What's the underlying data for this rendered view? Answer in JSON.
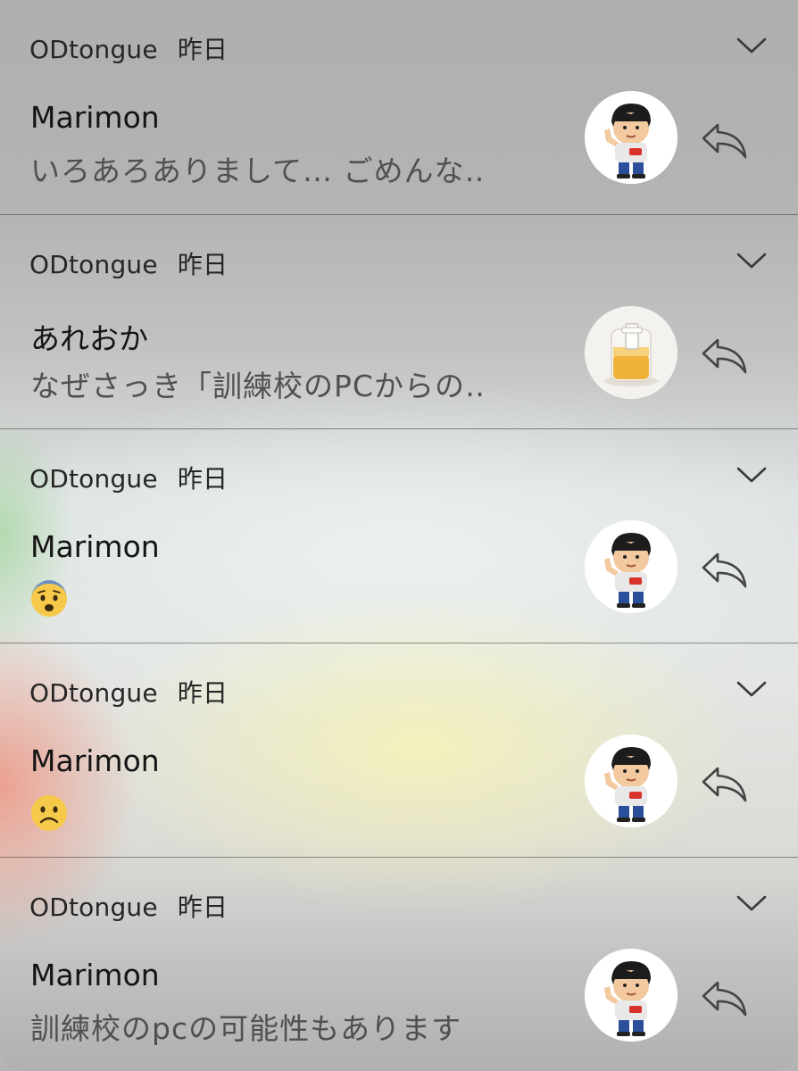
{
  "notifications": [
    {
      "app": "ODtongue",
      "time": "昨日",
      "sender": "Marimon",
      "message": "いろあろありまして… ごめんな‥",
      "avatar": "person-avatar"
    },
    {
      "app": "ODtongue",
      "time": "昨日",
      "sender": "あれおか",
      "message": "なぜさっき「訓練校のPCからの‥",
      "avatar": "pudding-jar-avatar"
    },
    {
      "app": "ODtongue",
      "time": "昨日",
      "sender": "Marimon",
      "message": "",
      "message_emoji": "fearful-face-emoji",
      "avatar": "person-avatar"
    },
    {
      "app": "ODtongue",
      "time": "昨日",
      "sender": "Marimon",
      "message": "",
      "message_emoji": "frowning-face-emoji",
      "avatar": "person-avatar"
    },
    {
      "app": "ODtongue",
      "time": "昨日",
      "sender": "Marimon",
      "message": "訓練校のpcの可能性もあります",
      "avatar": "person-avatar"
    }
  ],
  "icons": {
    "expand": "chevron-down-icon",
    "reply": "reply-icon"
  },
  "colors": {
    "header_text": "#262626",
    "sender_text": "#141414",
    "message_text": "#505050",
    "emoji_yellow": "#f7c94a"
  }
}
